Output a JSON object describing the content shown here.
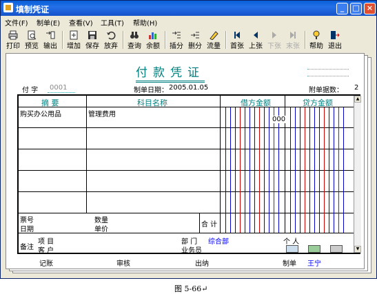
{
  "window": {
    "title": "填制凭证",
    "min_label": "_",
    "max_label": "□",
    "close_label": "×"
  },
  "menu": [
    {
      "label": "文件(F)"
    },
    {
      "label": "制单(E)"
    },
    {
      "label": "查看(V)"
    },
    {
      "label": "工具(T)"
    },
    {
      "label": "帮助(H)"
    }
  ],
  "toolbar": [
    {
      "label": "打印",
      "icon": "printer-icon",
      "enabled": true
    },
    {
      "label": "预览",
      "icon": "preview-icon",
      "enabled": true
    },
    {
      "label": "输出",
      "icon": "export-icon",
      "enabled": true
    },
    {
      "label": "增加",
      "icon": "add-icon",
      "enabled": true
    },
    {
      "label": "保存",
      "icon": "save-icon",
      "enabled": true
    },
    {
      "label": "放弃",
      "icon": "undo-icon",
      "enabled": true
    },
    {
      "label": "查询",
      "icon": "binoculars-icon",
      "enabled": true
    },
    {
      "label": "余额",
      "icon": "balance-chart-icon",
      "enabled": true
    },
    {
      "label": "插分",
      "icon": "insert-row-icon",
      "enabled": true
    },
    {
      "label": "删分",
      "icon": "delete-row-icon",
      "enabled": true
    },
    {
      "label": "流量",
      "icon": "cashflow-icon",
      "enabled": true
    },
    {
      "label": "首张",
      "icon": "first-icon",
      "enabled": true
    },
    {
      "label": "上张",
      "icon": "prev-icon",
      "enabled": true
    },
    {
      "label": "下张",
      "icon": "next-icon",
      "enabled": false
    },
    {
      "label": "末张",
      "icon": "last-icon",
      "enabled": false
    },
    {
      "label": "帮助",
      "icon": "help-icon",
      "enabled": true
    },
    {
      "label": "退出",
      "icon": "exit-icon",
      "enabled": true
    }
  ],
  "voucher": {
    "title": "付款凭证",
    "type_label": "付 字",
    "number": "0001",
    "date_label": "制单日期：",
    "date": "2005.01.05",
    "attachments_label": "附单据数：",
    "attachments": "2",
    "headers": {
      "summary": "摘 要",
      "account": "科目名称",
      "debit": "借方金额",
      "credit": "贷方金额"
    },
    "rows": [
      {
        "summary": "购买办公用品",
        "account": "管理费用",
        "debit": "000"
      },
      {
        "summary": "",
        "account": "",
        "debit": ""
      },
      {
        "summary": "",
        "account": "",
        "debit": ""
      },
      {
        "summary": "",
        "account": "",
        "debit": ""
      },
      {
        "summary": "",
        "account": "",
        "debit": ""
      }
    ],
    "bill_no_label": "票号",
    "date_row_label": "日期",
    "qty_label": "数量",
    "price_label": "单价",
    "total_label": "合 计",
    "remarks_label": "备注",
    "project_label": "项  目",
    "customer_label": "客  户",
    "dept_label": "部  门",
    "dept_value": "综合部",
    "person_label": "个  人",
    "salesman_label": "业务员",
    "footer": {
      "bookkeeper_label": "记账",
      "reviewer_label": "审核",
      "cashier_label": "出纳",
      "maker_label": "制单",
      "maker_value": "王宁"
    }
  },
  "caption": "图 5-66↵",
  "colors": {
    "accent": "#008080",
    "value_blue": "#0000ff",
    "debit_line_blue": "#0000cc",
    "debit_line_red": "#cc0000"
  }
}
